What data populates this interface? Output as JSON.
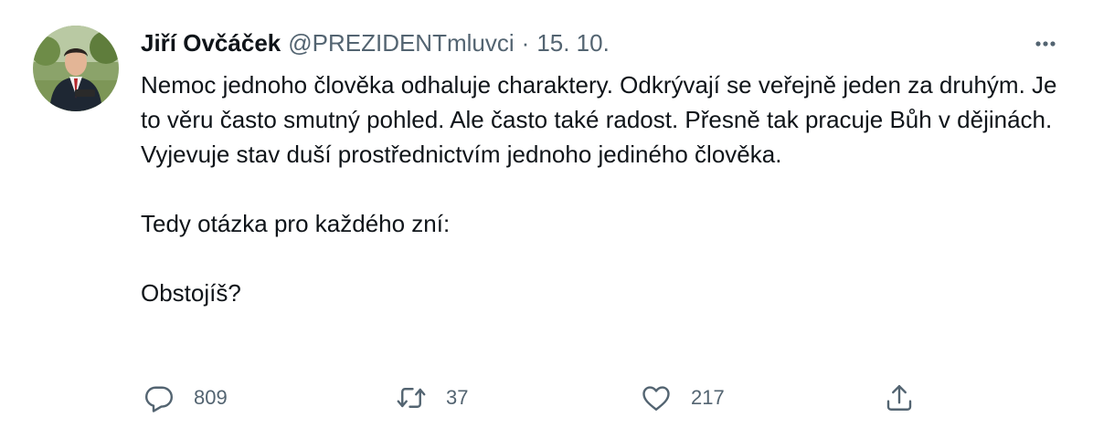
{
  "tweet": {
    "author": {
      "display_name": "Jiří Ovčáček",
      "handle": "@PREZIDENTmluvci"
    },
    "separator": "·",
    "date": "15. 10.",
    "body": [
      "Nemoc jednoho člověka odhaluje charaktery. Odkrývají se veřejně jeden za druhým. Je to věru často smutný pohled. Ale často také radost. Přesně tak pracuje Bůh v dějinách. Vyjevuje stav duší prostřednictvím jednoho jediného člověka.",
      "Tedy otázka pro každého zní:",
      "Obstojíš?"
    ],
    "actions": {
      "reply": {
        "icon": "reply-icon",
        "count": "809"
      },
      "retweet": {
        "icon": "retweet-icon",
        "count": "37"
      },
      "like": {
        "icon": "heart-icon",
        "count": "217"
      },
      "share": {
        "icon": "share-icon"
      }
    },
    "more": {
      "icon": "more-options-icon"
    }
  },
  "colors": {
    "text_primary": "#0f1419",
    "text_secondary": "#536471",
    "background": "#ffffff"
  }
}
